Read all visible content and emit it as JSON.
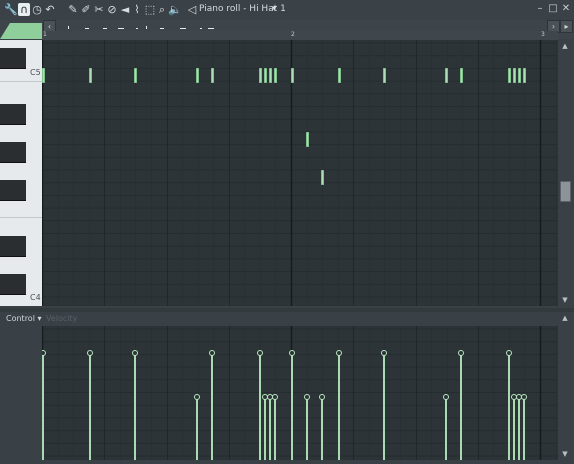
{
  "window": {
    "title": "Piano roll - Hi Hat 1",
    "title_arrow": "▾"
  },
  "toolbar": {
    "icons": [
      "wrench-icon",
      "magnet-icon",
      "clock-icon",
      "undo-icon",
      "pencil-icon",
      "paint-icon",
      "delete-icon",
      "mute-icon",
      "slice-icon",
      "select-icon",
      "zoom-icon",
      "speaker-icon",
      "playback-icon"
    ]
  },
  "window_buttons": {
    "minimize": "–",
    "maximize": "□",
    "close": "✕"
  },
  "ruler": {
    "bars": [
      "1",
      "2",
      "3"
    ]
  },
  "keyboard": {
    "labels": [
      "C5",
      "C4"
    ]
  },
  "notes": [
    {
      "start": 0.0,
      "row": "C5"
    },
    {
      "start": 0.19,
      "row": "C5"
    },
    {
      "start": 0.37,
      "row": "C5"
    },
    {
      "start": 0.62,
      "row": "C5"
    },
    {
      "start": 0.68,
      "row": "C5"
    },
    {
      "start": 0.87,
      "row": "C5"
    },
    {
      "start": 0.89,
      "row": "C5"
    },
    {
      "start": 0.91,
      "row": "C5"
    },
    {
      "start": 0.93,
      "row": "C5"
    },
    {
      "start": 1.0,
      "row": "C5"
    },
    {
      "start": 1.06,
      "row": "G4"
    },
    {
      "start": 1.12,
      "row": "E4"
    },
    {
      "start": 1.19,
      "row": "C5"
    },
    {
      "start": 1.37,
      "row": "C5"
    },
    {
      "start": 1.62,
      "row": "C5"
    },
    {
      "start": 1.68,
      "row": "C5"
    },
    {
      "start": 1.87,
      "row": "C5"
    },
    {
      "start": 1.89,
      "row": "C5"
    },
    {
      "start": 1.91,
      "row": "C5"
    },
    {
      "start": 1.93,
      "row": "C5"
    }
  ],
  "control": {
    "label": "Control",
    "arrow": "▾",
    "sub": "Velocity"
  },
  "velocities": [
    {
      "start": 0.0,
      "vel": 0.87
    },
    {
      "start": 0.19,
      "vel": 0.87
    },
    {
      "start": 0.37,
      "vel": 0.87
    },
    {
      "start": 0.62,
      "vel": 0.5
    },
    {
      "start": 0.68,
      "vel": 0.87
    },
    {
      "start": 0.87,
      "vel": 0.87
    },
    {
      "start": 0.89,
      "vel": 0.5
    },
    {
      "start": 0.91,
      "vel": 0.5
    },
    {
      "start": 0.93,
      "vel": 0.5
    },
    {
      "start": 1.0,
      "vel": 0.87
    },
    {
      "start": 1.06,
      "vel": 0.5
    },
    {
      "start": 1.12,
      "vel": 0.5
    },
    {
      "start": 1.19,
      "vel": 0.87
    },
    {
      "start": 1.37,
      "vel": 0.87
    },
    {
      "start": 1.62,
      "vel": 0.5
    },
    {
      "start": 1.68,
      "vel": 0.87
    },
    {
      "start": 1.87,
      "vel": 0.87
    },
    {
      "start": 1.89,
      "vel": 0.5
    },
    {
      "start": 1.91,
      "vel": 0.5
    },
    {
      "start": 1.93,
      "vel": 0.5
    }
  ],
  "colors": {
    "note": "#aee0b6",
    "grid_bg": "#2c3438",
    "accent": "#9ad8a4"
  }
}
